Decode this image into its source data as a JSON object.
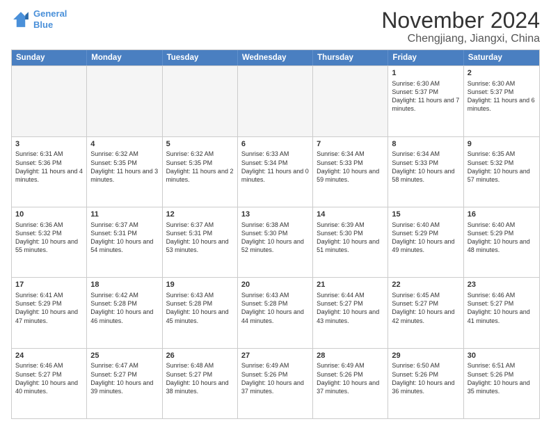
{
  "logo": {
    "line1": "General",
    "line2": "Blue"
  },
  "title": "November 2024",
  "location": "Chengjiang, Jiangxi, China",
  "days": [
    "Sunday",
    "Monday",
    "Tuesday",
    "Wednesday",
    "Thursday",
    "Friday",
    "Saturday"
  ],
  "weeks": [
    [
      {
        "day": "",
        "info": "",
        "empty": true
      },
      {
        "day": "",
        "info": "",
        "empty": true
      },
      {
        "day": "",
        "info": "",
        "empty": true
      },
      {
        "day": "",
        "info": "",
        "empty": true
      },
      {
        "day": "",
        "info": "",
        "empty": true
      },
      {
        "day": "1",
        "info": "Sunrise: 6:30 AM\nSunset: 5:37 PM\nDaylight: 11 hours and 7 minutes."
      },
      {
        "day": "2",
        "info": "Sunrise: 6:30 AM\nSunset: 5:37 PM\nDaylight: 11 hours and 6 minutes."
      }
    ],
    [
      {
        "day": "3",
        "info": "Sunrise: 6:31 AM\nSunset: 5:36 PM\nDaylight: 11 hours and 4 minutes."
      },
      {
        "day": "4",
        "info": "Sunrise: 6:32 AM\nSunset: 5:35 PM\nDaylight: 11 hours and 3 minutes."
      },
      {
        "day": "5",
        "info": "Sunrise: 6:32 AM\nSunset: 5:35 PM\nDaylight: 11 hours and 2 minutes."
      },
      {
        "day": "6",
        "info": "Sunrise: 6:33 AM\nSunset: 5:34 PM\nDaylight: 11 hours and 0 minutes."
      },
      {
        "day": "7",
        "info": "Sunrise: 6:34 AM\nSunset: 5:33 PM\nDaylight: 10 hours and 59 minutes."
      },
      {
        "day": "8",
        "info": "Sunrise: 6:34 AM\nSunset: 5:33 PM\nDaylight: 10 hours and 58 minutes."
      },
      {
        "day": "9",
        "info": "Sunrise: 6:35 AM\nSunset: 5:32 PM\nDaylight: 10 hours and 57 minutes."
      }
    ],
    [
      {
        "day": "10",
        "info": "Sunrise: 6:36 AM\nSunset: 5:32 PM\nDaylight: 10 hours and 55 minutes."
      },
      {
        "day": "11",
        "info": "Sunrise: 6:37 AM\nSunset: 5:31 PM\nDaylight: 10 hours and 54 minutes."
      },
      {
        "day": "12",
        "info": "Sunrise: 6:37 AM\nSunset: 5:31 PM\nDaylight: 10 hours and 53 minutes."
      },
      {
        "day": "13",
        "info": "Sunrise: 6:38 AM\nSunset: 5:30 PM\nDaylight: 10 hours and 52 minutes."
      },
      {
        "day": "14",
        "info": "Sunrise: 6:39 AM\nSunset: 5:30 PM\nDaylight: 10 hours and 51 minutes."
      },
      {
        "day": "15",
        "info": "Sunrise: 6:40 AM\nSunset: 5:29 PM\nDaylight: 10 hours and 49 minutes."
      },
      {
        "day": "16",
        "info": "Sunrise: 6:40 AM\nSunset: 5:29 PM\nDaylight: 10 hours and 48 minutes."
      }
    ],
    [
      {
        "day": "17",
        "info": "Sunrise: 6:41 AM\nSunset: 5:29 PM\nDaylight: 10 hours and 47 minutes."
      },
      {
        "day": "18",
        "info": "Sunrise: 6:42 AM\nSunset: 5:28 PM\nDaylight: 10 hours and 46 minutes."
      },
      {
        "day": "19",
        "info": "Sunrise: 6:43 AM\nSunset: 5:28 PM\nDaylight: 10 hours and 45 minutes."
      },
      {
        "day": "20",
        "info": "Sunrise: 6:43 AM\nSunset: 5:28 PM\nDaylight: 10 hours and 44 minutes."
      },
      {
        "day": "21",
        "info": "Sunrise: 6:44 AM\nSunset: 5:27 PM\nDaylight: 10 hours and 43 minutes."
      },
      {
        "day": "22",
        "info": "Sunrise: 6:45 AM\nSunset: 5:27 PM\nDaylight: 10 hours and 42 minutes."
      },
      {
        "day": "23",
        "info": "Sunrise: 6:46 AM\nSunset: 5:27 PM\nDaylight: 10 hours and 41 minutes."
      }
    ],
    [
      {
        "day": "24",
        "info": "Sunrise: 6:46 AM\nSunset: 5:27 PM\nDaylight: 10 hours and 40 minutes."
      },
      {
        "day": "25",
        "info": "Sunrise: 6:47 AM\nSunset: 5:27 PM\nDaylight: 10 hours and 39 minutes."
      },
      {
        "day": "26",
        "info": "Sunrise: 6:48 AM\nSunset: 5:27 PM\nDaylight: 10 hours and 38 minutes."
      },
      {
        "day": "27",
        "info": "Sunrise: 6:49 AM\nSunset: 5:26 PM\nDaylight: 10 hours and 37 minutes."
      },
      {
        "day": "28",
        "info": "Sunrise: 6:49 AM\nSunset: 5:26 PM\nDaylight: 10 hours and 37 minutes."
      },
      {
        "day": "29",
        "info": "Sunrise: 6:50 AM\nSunset: 5:26 PM\nDaylight: 10 hours and 36 minutes."
      },
      {
        "day": "30",
        "info": "Sunrise: 6:51 AM\nSunset: 5:26 PM\nDaylight: 10 hours and 35 minutes."
      }
    ]
  ]
}
